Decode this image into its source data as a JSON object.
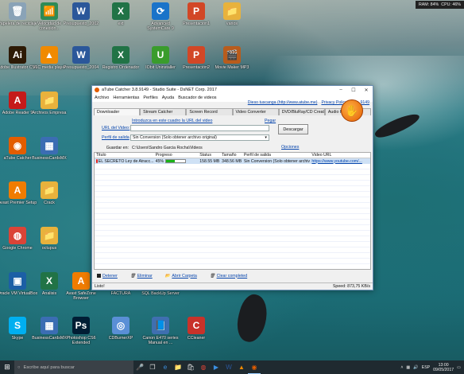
{
  "sysmon": {
    "ram": "RAM: 84%",
    "cpu": "CPU: 46%"
  },
  "desktop_icons": [
    {
      "label": "Papelera de reciclaje",
      "glyph": "🗑",
      "bg": "#8aa3b7"
    },
    {
      "label": "Velocidad de conexión...",
      "glyph": "📶",
      "bg": "#2e8b57"
    },
    {
      "label": "Presupuesto_2002",
      "glyph": "W",
      "bg": "#2b579a"
    },
    {
      "label": "ext",
      "glyph": "X",
      "bg": "#217346"
    },
    {
      "label": "Advanced SystemCare 9",
      "glyph": "⟳",
      "bg": "#1a73c9"
    },
    {
      "label": "Presentación1",
      "glyph": "P",
      "bg": "#d24726"
    },
    {
      "label": "varios",
      "glyph": "📁",
      "bg": "#e8b23c"
    },
    {
      "label": "Adobe Illustrator CS6",
      "glyph": "Ai",
      "bg": "#2d1a05"
    },
    {
      "label": "VLC media player",
      "glyph": "▲",
      "bg": "#f08a00"
    },
    {
      "label": "Presupuesto_2004",
      "glyph": "W",
      "bg": "#2b579a"
    },
    {
      "label": "Registro Ordenador",
      "glyph": "X",
      "bg": "#217346"
    },
    {
      "label": "IObit Uninstaller",
      "glyph": "U",
      "bg": "#3a9c2c"
    },
    {
      "label": "Presentación2",
      "glyph": "P",
      "bg": "#d24726"
    },
    {
      "label": "Movie Maker MP3",
      "glyph": "🎬",
      "bg": "#b85c1c"
    },
    {
      "label": "Adobe Reader 9",
      "glyph": "A",
      "bg": "#c51a1a"
    },
    {
      "label": "Archivos Empresa",
      "glyph": "📁",
      "bg": "#e8b23c"
    },
    {
      "label": "aTube Catcher",
      "glyph": "◉",
      "bg": "#e35d00"
    },
    {
      "label": "BusinessCardsMX",
      "glyph": "▦",
      "bg": "#3b6db3"
    },
    {
      "label": "Avast Premier Setup",
      "glyph": "A",
      "bg": "#f07c00"
    },
    {
      "label": "Crack",
      "glyph": "📁",
      "bg": "#e8b23c"
    },
    {
      "label": "Google Chrome",
      "glyph": "◍",
      "bg": "#db4437"
    },
    {
      "label": "octupus",
      "glyph": "📁",
      "bg": "#e8b23c"
    },
    {
      "label": "Oracle VM VirtualBox",
      "glyph": "▣",
      "bg": "#1c5fa5"
    },
    {
      "label": "Analisis",
      "glyph": "X",
      "bg": "#217346"
    },
    {
      "label": "Avast SafeZone Browser",
      "glyph": "A",
      "bg": "#f07c00"
    },
    {
      "label": "FACTURA",
      "glyph": "📄",
      "bg": "#6b7b8c"
    },
    {
      "label": "SQL BackUp Server",
      "glyph": "S",
      "bg": "#7a5aa6"
    },
    {
      "label": "Skype",
      "glyph": "S",
      "bg": "#00aff0"
    },
    {
      "label": "BusinessCardsMX",
      "glyph": "▦",
      "bg": "#3b6db3"
    },
    {
      "label": "Photoshop CS6 Extended",
      "glyph": "Ps",
      "bg": "#001d34"
    },
    {
      "label": "CDBurnerXP",
      "glyph": "◎",
      "bg": "#5a8fd6"
    },
    {
      "label": "Canon E470 series Manual en ...",
      "glyph": "📘",
      "bg": "#3f6fb0"
    },
    {
      "label": "CCleaner",
      "glyph": "C",
      "bg": "#c8322a"
    }
  ],
  "window": {
    "title": "aTube Catcher 3.8.9149 - Studio Suite - DsNET Corp. 2017",
    "menu": [
      "Archivo",
      "Herramientas",
      "Perfiles",
      "Ayuda",
      "Buscador de videos"
    ],
    "top_links": [
      "Dieso tuscanga (http://www.atube.me)",
      "Privacy Policy",
      "Rev. 9149"
    ],
    "tabs": [
      "Downloader",
      "Stream Catcher",
      "Screen Record",
      "Video Converter",
      "DVD/BluRay/CD Creator",
      "Audio Recorder"
    ],
    "intro": "Introduzca en este cuadro la URL del video",
    "pegar": "Pegar",
    "url_label": "URL del Video:",
    "url_value": "",
    "profile_label": "Perfil de salida",
    "profile_value": "Sin Conversion (Solo obtener archivo original)",
    "save_label": "Guardar en:",
    "save_path": "C:\\Users\\Sandro Garcia Rocha\\Videos",
    "download_button": "Descargar",
    "options_link": "Opciones",
    "columns": [
      "Titulo",
      "Progreso",
      "Status",
      "Tamaño",
      "Perfil de salida",
      "Video URL"
    ],
    "rows": [
      {
        "title": "EL SECRETO Ley de Atracc...",
        "progress": "45%",
        "progress_value": 0.45,
        "status": "158.55 MB",
        "size": "348.56 MB",
        "profile": "Sin Conversion (Solo obtener archiv...",
        "url": "https://www.youtube.com/..."
      }
    ],
    "bottom_buttons": [
      "Detener",
      "Eliminar",
      "Abrir Carpeta",
      "Clear completed"
    ],
    "status_left": "Listo!",
    "status_right": "Speed: 873,75 KB/s"
  },
  "taskbar": {
    "search_placeholder": "Escribe aquí para buscar",
    "lang": "ESP",
    "time": "13:00",
    "date": "09/05/2017"
  }
}
